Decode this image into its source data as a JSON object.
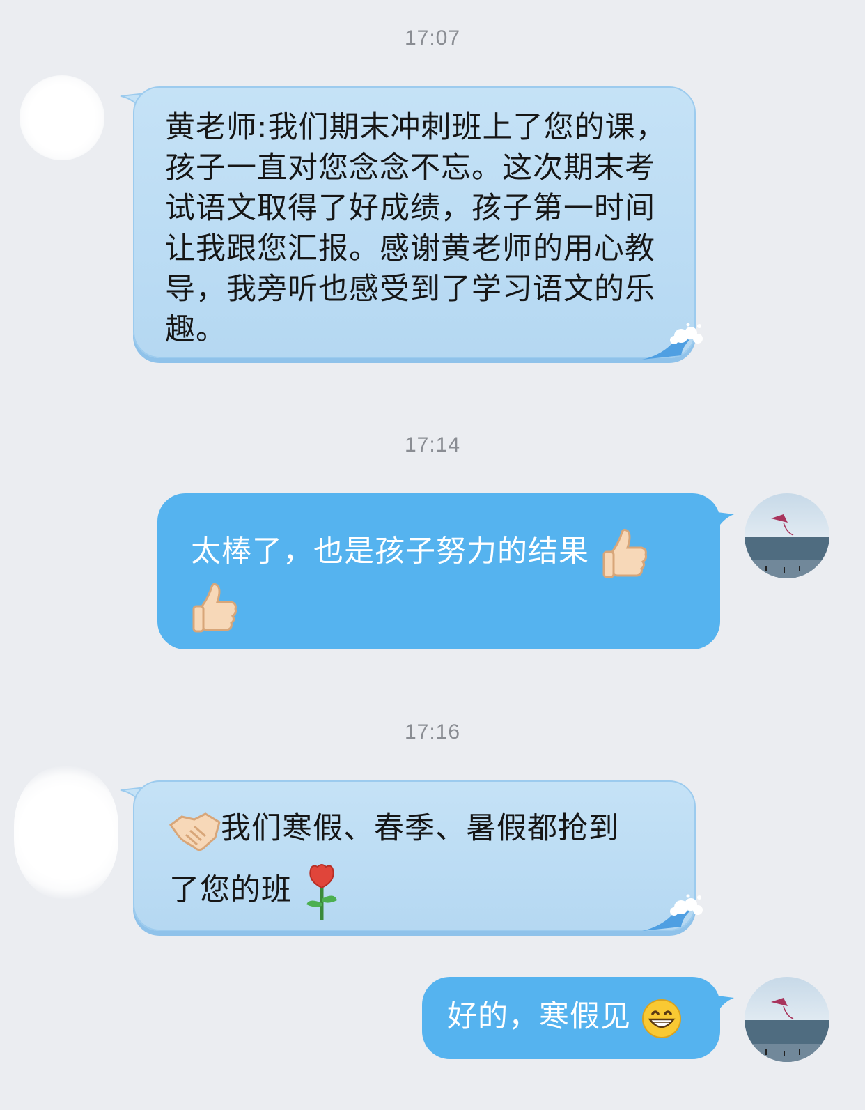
{
  "messages": [
    {
      "time": "17:07",
      "direction": "in",
      "text": "黄老师:我们期末冲刺班上了您的课，孩子一直对您念念不忘。这次期末考试语文取得了好成绩，孩子第一时间让我跟您汇报。感谢黄老师的用心教导，我旁听也感受到了学习语文的乐趣。"
    },
    {
      "time": "17:14",
      "direction": "out",
      "text": "太棒了，也是孩子努力的结果",
      "emojis": [
        "thumbs-up",
        "thumbs-up"
      ]
    },
    {
      "time": "17:16",
      "direction": "in",
      "emoji_before": "handshake",
      "text_line1": "我们寒假、春季、暑假都抢到",
      "text_line2": "了您的班",
      "emoji_after": "rose"
    },
    {
      "direction": "out",
      "text": "好的，寒假见",
      "emoji": "grinning-face"
    }
  ],
  "colors": {
    "background": "#ebedf1",
    "incoming_bubble": "#bddcf4",
    "outgoing_bubble": "#55b3ef",
    "timestamp": "#8a8d93"
  }
}
